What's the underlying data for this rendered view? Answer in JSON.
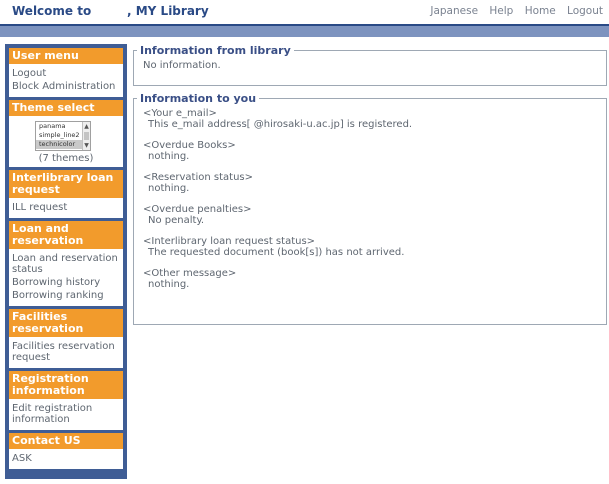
{
  "header": {
    "welcome": "Welcome to",
    "library": ", MY Library",
    "links": [
      "Japanese",
      "Help",
      "Home",
      "Logout"
    ]
  },
  "sidebar": {
    "user_menu": {
      "title": "User menu",
      "items": [
        "Logout",
        "Block Administration"
      ]
    },
    "theme_select": {
      "title": "Theme select",
      "options": [
        "panama",
        "simple_line2",
        "technicolor"
      ],
      "selected": "technicolor",
      "count_text": "(7 themes)"
    },
    "ill": {
      "title": "Interlibrary loan request",
      "items": [
        "ILL request"
      ]
    },
    "loan": {
      "title": "Loan and reservation",
      "items": [
        "Loan and reservation status",
        "Borrowing history",
        "Borrowing ranking"
      ]
    },
    "facilities": {
      "title": "Facilities reservation",
      "items": [
        "Facilities reservation request"
      ]
    },
    "registration": {
      "title": "Registration information",
      "items": [
        "Edit registration information"
      ]
    },
    "contact": {
      "title": "Contact US",
      "items": [
        "ASK"
      ]
    }
  },
  "library_info": {
    "title": "Information from library",
    "text": "No information."
  },
  "user_info": {
    "title": "Information to you",
    "blocks": [
      {
        "heading": "<Your e_mail>",
        "value": "This e_mail address[        @hirosaki-u.ac.jp] is registered."
      },
      {
        "heading": "<Overdue Books>",
        "value": "nothing."
      },
      {
        "heading": "<Reservation status>",
        "value": "nothing."
      },
      {
        "heading": "<Overdue penalties>",
        "value": "No penalty."
      },
      {
        "heading": "<Interlibrary loan request status>",
        "value": "The requested document (book[s]) has not arrived."
      },
      {
        "heading": "<Other message>",
        "value": "nothing."
      }
    ]
  },
  "colors": {
    "brand_blue": "#2a4a86",
    "sidebar_bg": "#3f5d95",
    "menu_header": "#f29b2c",
    "band": "#7d93bf"
  }
}
